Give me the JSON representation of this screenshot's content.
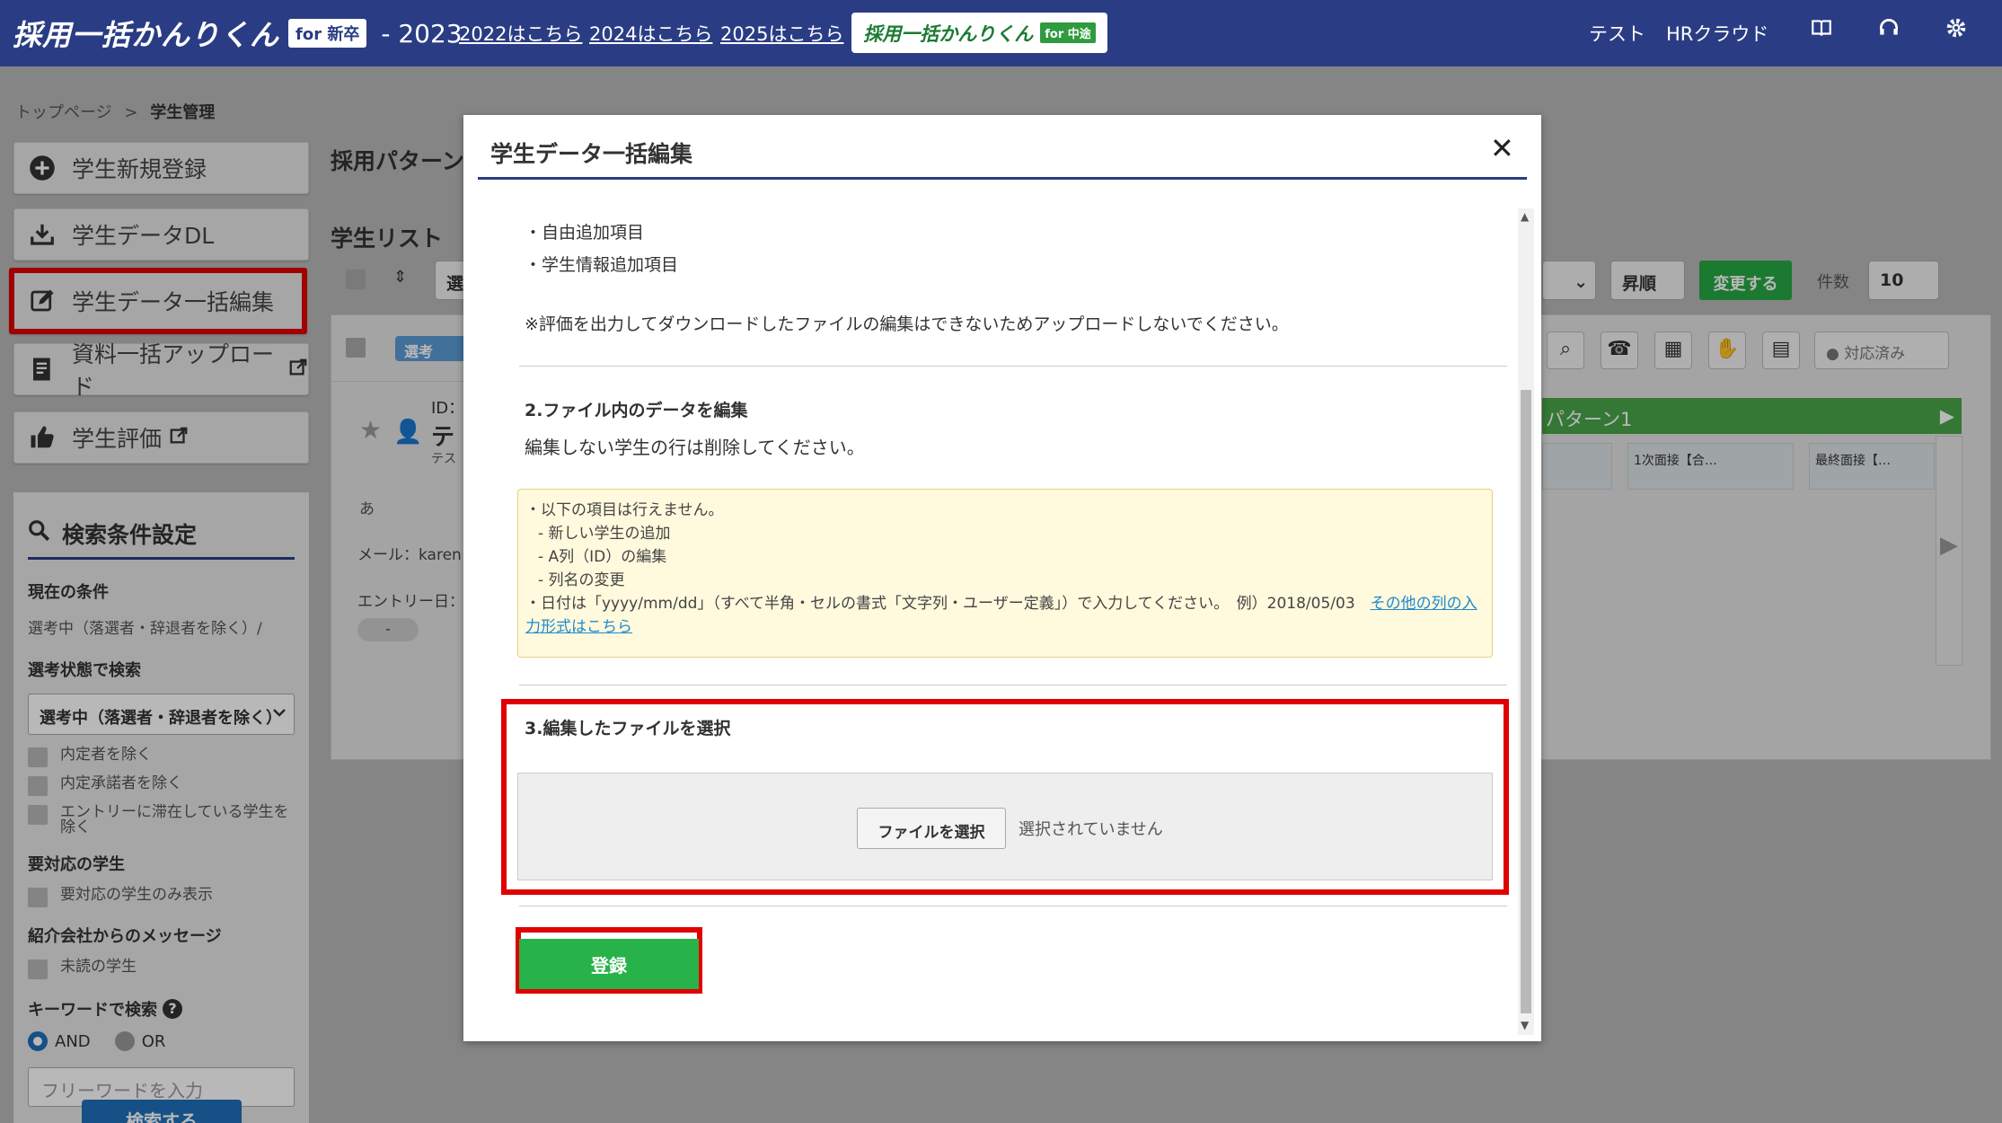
{
  "header": {
    "logo_text": "採用一括かんりくん",
    "logo_tag": "for 新卒",
    "year": "- 2023",
    "links": [
      "2022はこちら",
      "2024はこちら",
      "2025はこちら"
    ],
    "mid_logo_text": "採用一括かんりくん",
    "mid_logo_tag": "for 中途",
    "user_name": "テスト",
    "company": "HRクラウド",
    "icons": [
      "book-icon",
      "headset-icon",
      "gear-icon"
    ]
  },
  "breadcrumb": {
    "home": "トップページ",
    "sep": ">",
    "current": "学生管理"
  },
  "menu": {
    "items": [
      {
        "label": "学生新規登録",
        "icon": "plus-circle-icon"
      },
      {
        "label": "学生データDL",
        "icon": "download-icon"
      },
      {
        "label": "学生データ一括編集",
        "icon": "edit-icon"
      },
      {
        "label": "資料一括アップロード",
        "icon": "document-icon"
      },
      {
        "label": "学生評価",
        "icon": "thumbs-up-icon"
      }
    ]
  },
  "search": {
    "title": "検索条件設定",
    "current_label": "現在の条件",
    "current_value": "選考中（落選者・辞退者を除く）/",
    "status_label": "選考状態で検索",
    "status_value": "選考中（落選者・辞退者を除く）",
    "checks1": [
      "内定者を除く",
      "内定承諾者を除く",
      "エントリーに滞在している学生を除く"
    ],
    "need_label": "要対応の学生",
    "need_check": "要対応の学生のみ表示",
    "agent_label": "紹介会社からのメッセージ",
    "agent_check": "未読の学生",
    "keyword_label": "キーワードで検索",
    "radio_and": "AND",
    "radio_or": "OR",
    "keyword_placeholder": "フリーワードを入力",
    "search_button": "検索する"
  },
  "main": {
    "pattern_title": "採用パターン",
    "list_title": "学生リスト",
    "select_partial": "選",
    "sort_value": "昇順",
    "change_button": "変更する",
    "count_label": "件数",
    "count_value": "10",
    "status_filter": "対応済み",
    "badge_partial": "選考",
    "id_label": "ID：",
    "name_partial": "テ",
    "name_sub": "テス",
    "kana": "あ",
    "mail_label": "メール：karen",
    "entry_label": "エントリー日：",
    "entry_value": "-",
    "pattern_bar": "パターン1",
    "stages": [
      "1次面接【合…",
      "最終面接【…"
    ]
  },
  "modal": {
    "title": "学生データ一括編集",
    "bullets": [
      "・自由追加項目",
      "・学生情報追加項目"
    ],
    "eval_note": "※評価を出力してダウンロードしたファイルの編集はできないためアップロードしないでください。",
    "step2_title": "2.ファイル内のデータを編集",
    "step2_desc": "編集しない学生の行は削除してください。",
    "notice_lines": [
      "・以下の項目は行えません。",
      "- 新しい学生の追加",
      "- A列（ID）の編集",
      "- 列名の変更"
    ],
    "notice_date": "・日付は「yyyy/mm/dd」（すべて半角・セルの書式「文字列・ユーザー定義」）で入力してください。　例）2018/05/03　",
    "notice_link": "その他の列の入力形式はこちら",
    "step3_title": "3.編集したファイルを選択",
    "file_button": "ファイルを選択",
    "file_status": "選択されていません",
    "register_button": "登録"
  },
  "colors": {
    "header": "#2a3d84",
    "green": "#27b24a",
    "highlight": "#e00000",
    "accent_blue": "#1f6fba"
  }
}
